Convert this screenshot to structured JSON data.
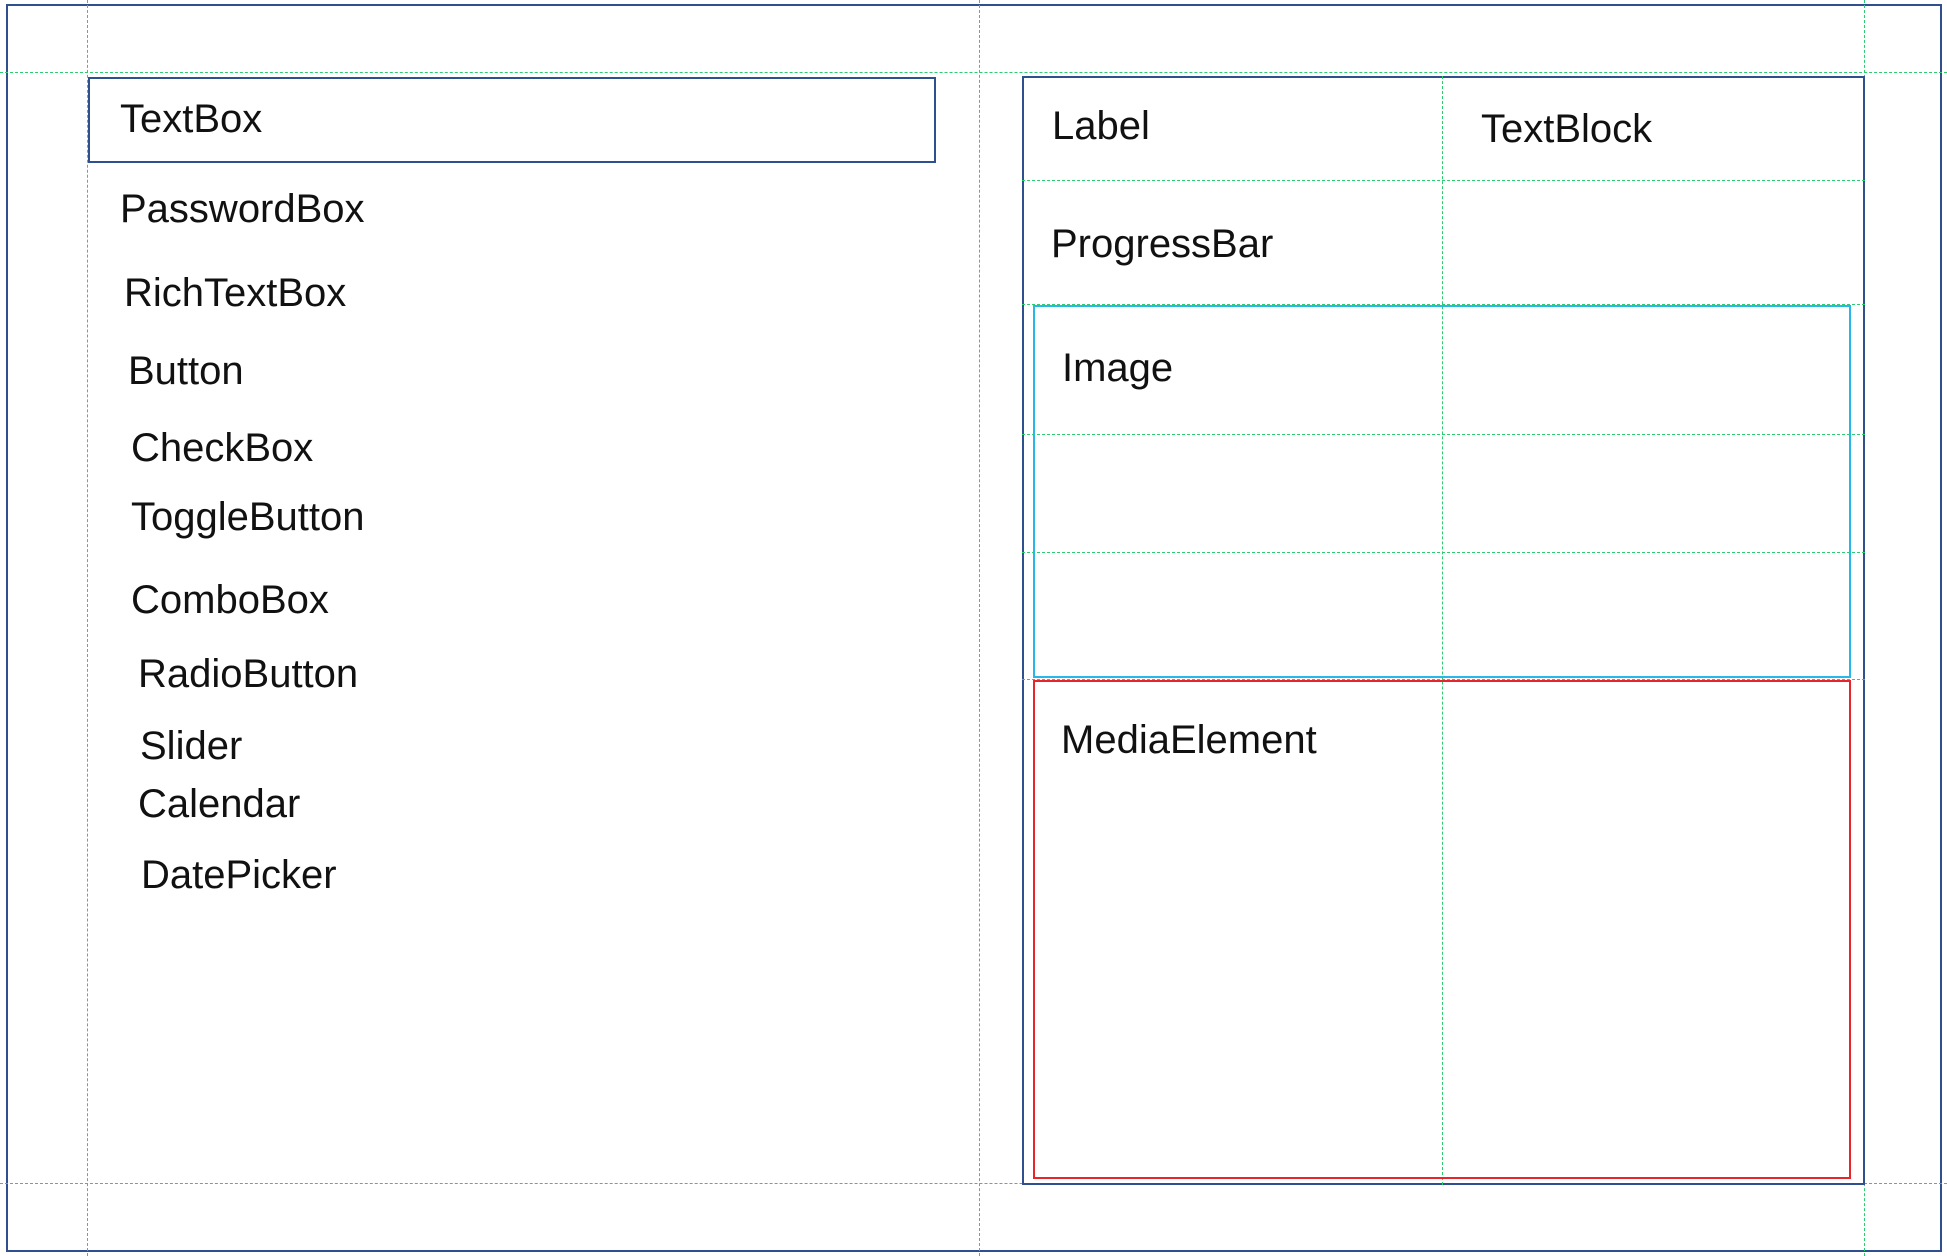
{
  "left_panel": {
    "textbox": "TextBox",
    "passwordbox": "PasswordBox",
    "richtextbox": "RichTextBox",
    "button": "Button",
    "checkbox": "CheckBox",
    "togglebutton": "ToggleButton",
    "combobox": "ComboBox",
    "radiobutton": "RadioButton",
    "slider": "Slider",
    "calendar": "Calendar",
    "datepicker": "DatePicker"
  },
  "right_panel": {
    "label": "Label",
    "textblock": "TextBlock",
    "progressbar": "ProgressBar",
    "image": "Image",
    "mediaelement": "MediaElement"
  },
  "colors": {
    "frame_border": "#2f4f8f",
    "guide_lines": "#2ecc71",
    "image_region": "#29b6e8",
    "media_region": "#e8252a"
  }
}
